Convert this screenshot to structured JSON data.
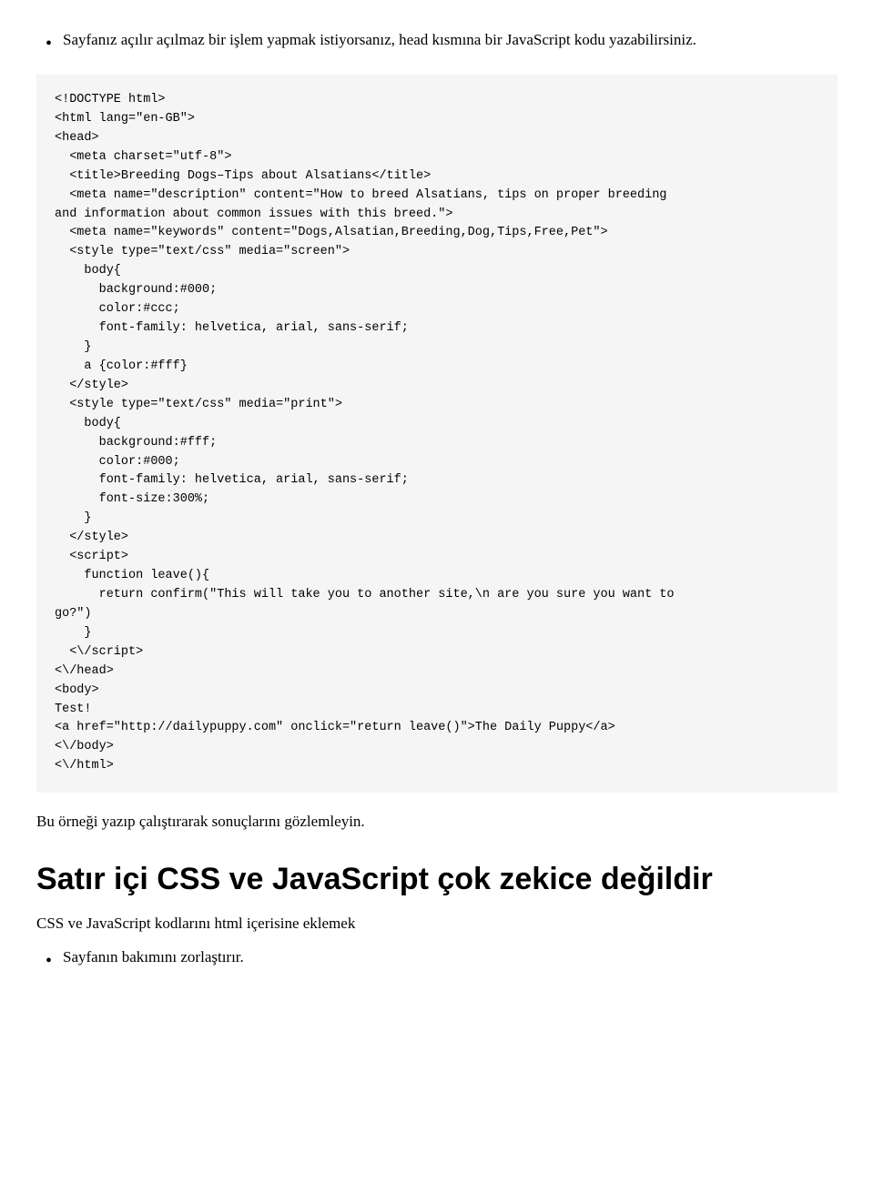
{
  "intro_bullet": {
    "dot": "•",
    "text": "Sayfanız açılır açılmaz bir işlem yapmak istiyorsanız, head kısmına bir JavaScript kodu yazabilirsiniz."
  },
  "code_content": "<!DOCTYPE html>\n<html lang=\"en-GB\">\n<head>\n  <meta charset=\"utf-8\">\n  <title>Breeding Dogs–Tips about Alsatians</title>\n  <meta name=\"description\" content=\"How to breed Alsatians, tips on proper breeding\nand information about common issues with this breed.\">\n  <meta name=\"keywords\" content=\"Dogs,Alsatian,Breeding,Dog,Tips,Free,Pet\">\n  <style type=\"text/css\" media=\"screen\">\n    body{\n      background:#000;\n      color:#ccc;\n      font-family: helvetica, arial, sans-serif;\n    }\n    a {color:#fff}\n  </style>\n  <style type=\"text/css\" media=\"print\">\n    body{\n      background:#fff;\n      color:#000;\n      font-family: helvetica, arial, sans-serif;\n      font-size:300%;\n    }\n  </style>\n  <script>\n    function leave(){\n      return confirm(\"This will take you to another site,\\n are you sure you want to\ngo?\")\n    }\n  <\\/script>\n<\\/head>\n<body>\nTest!\n<a href=\"http://dailypuppy.com\" onclick=\"return leave()\">The Daily Puppy</a>\n<\\/body>\n<\\/html>",
  "example_note": "Bu örneği yazıp çalıştırarak sonuçlarını gözlemleyin.",
  "section_heading": "Satır içi CSS ve JavaScript çok zekice değildir",
  "section_sub": "CSS ve JavaScript kodlarını html içerisine eklemek",
  "last_bullet": {
    "dot": "•",
    "text": "Sayfanın bakımını zorlaştırır."
  }
}
